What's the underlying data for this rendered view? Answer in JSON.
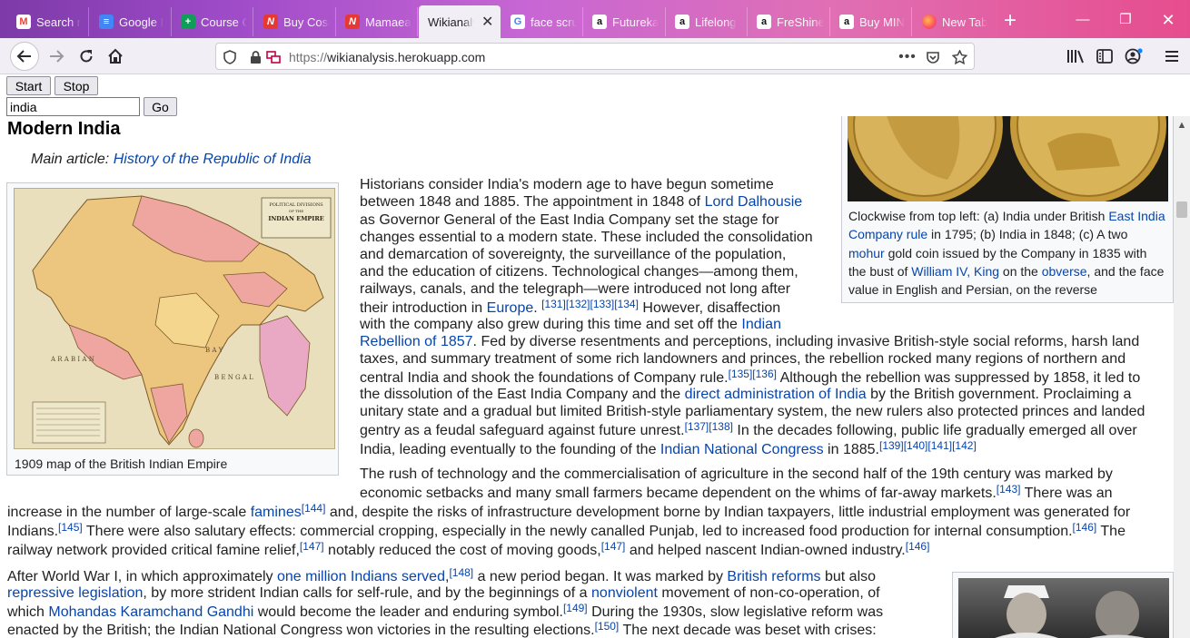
{
  "browser": {
    "tabs": [
      {
        "title": "Search r",
        "icon": "gmail-icon",
        "color": "#ea4335"
      },
      {
        "title": "Google I",
        "icon": "google-docs-icon",
        "color": "#4285f4"
      },
      {
        "title": "Course C",
        "icon": "google-sheets-icon",
        "color": "#0f9d58"
      },
      {
        "title": "Buy Cosr",
        "icon": "brand-n-icon",
        "color": "#e53935"
      },
      {
        "title": "Mamaea",
        "icon": "brand-n-icon",
        "color": "#e53935"
      },
      {
        "title": "Wikianaly",
        "icon": "none",
        "color": "#f1eef5",
        "active": true
      },
      {
        "title": "face scru",
        "icon": "google-icon",
        "color": "#4285f4"
      },
      {
        "title": "Futureka",
        "icon": "amazon-icon",
        "color": "#ffffff"
      },
      {
        "title": "Lifelong",
        "icon": "amazon-icon",
        "color": "#ffffff"
      },
      {
        "title": "FreShine",
        "icon": "amazon-icon",
        "color": "#ffffff"
      },
      {
        "title": "Buy MIN",
        "icon": "amazon-icon",
        "color": "#ffffff"
      },
      {
        "title": "New Tab",
        "icon": "firefox-icon",
        "color": "#ff7139"
      }
    ],
    "url_scheme": "https://",
    "url_host": "wikianalysis.herokuapp.com"
  },
  "controls": {
    "start_label": "Start",
    "stop_label": "Stop",
    "search_value": "india",
    "go_label": "Go"
  },
  "article": {
    "section_title": "Modern India",
    "main_article_prefix": "Main article: ",
    "main_article_link": "History of the Republic of India",
    "map_caption": "1909 map of the British Indian Empire",
    "coin_caption": {
      "t1": "Clockwise from top left: (a) India under British ",
      "l1": "East India Company rule",
      "t2": " in 1795; (b) India in 1848; (c) A two ",
      "l2": "mohur",
      "t3": " gold coin issued by the Company in 1835 with the bust of ",
      "l3": "William IV, King",
      "t4": " on the ",
      "l4": "obverse",
      "t5": ", and the face value in English and Persian, on the reverse"
    },
    "map_labels": {
      "title_small": "POLITICAL DIVISIONS",
      "title_of": "OF THE",
      "title_big": "INDIAN EMPIRE",
      "arabian": "A R A B I A N",
      "bay": "B A Y",
      "bengal": "B E N G A L"
    },
    "refs": {
      "r131": "[131]",
      "r132": "[132]",
      "r133": "[133]",
      "r134": "[134]",
      "r135": "[135]",
      "r136": "[136]",
      "r137": "[137]",
      "r138": "[138]",
      "r139": "[139]",
      "r140": "[140]",
      "r141": "[141]",
      "r142": "[142]",
      "r143": "[143]",
      "r144": "[144]",
      "r145": "[145]",
      "r146": "[146]",
      "r147": "[147]",
      "r148": "[148]",
      "r149": "[149]",
      "r150": "[150]"
    },
    "p1": {
      "l1": "Historians consider India's modern age to have begun sometime",
      "l2a": "between 1848 and 1885. The appointment in 1848 of ",
      "l2link": "Lord Dalhousie",
      "l3": "as Governor General of the East India Company set the stage for",
      "l4": "changes essential to a modern state. These included the consolidation",
      "l5": "and demarcation of sovereignty, the surveillance of the population,",
      "l6": "and the education of citizens. Technological changes—among them,",
      "l7": "railways, canals, and the telegraph—were introduced not long after",
      "l8a": "their introduction in ",
      "l8link": "Europe",
      "l8b": ". ",
      "l8c": " However, disaffection",
      "l9a": "with the company also grew during this time and set off the ",
      "l9link": "Indian",
      "l10link": "Rebellion of 1857",
      "l10b": ". Fed by diverse resentments and perceptions, including invasive British-style social reforms, harsh land",
      "l11": "taxes, and summary treatment of some rich landowners and princes, the rebellion rocked many regions of northern and",
      "l12a": "central India and shook the foundations of Company rule.",
      "l12b": " Although the rebellion was suppressed by 1858, it led to",
      "l13a": "the dissolution of the East India Company and the ",
      "l13link": "direct administration of India",
      "l13b": " by the British government. Proclaiming a",
      "l14": "unitary state and a gradual but limited British-style parliamentary system, the new rulers also protected princes and landed",
      "l15a": "gentry as a feudal safeguard against future unrest.",
      "l15b": " In the decades following, public life gradually emerged all over",
      "l16a": "India, leading eventually to the founding of the ",
      "l16link": "Indian National Congress",
      "l16b": " in 1885."
    },
    "p2": {
      "l1": "The rush of technology and the commercialisation of agriculture in the second half of the 19th century was marked by",
      "l2a": "economic setbacks and many small farmers became dependent on the whims of far-away markets.",
      "l2b": " There was an",
      "l3a": "increase in the number of large-scale ",
      "l3link": "famines",
      "l3b": " and, despite the risks of infrastructure development borne by Indian taxpayers, little industrial employment was generated for",
      "l4a": "Indians.",
      "l4b": " There were also salutary effects: commercial cropping, especially in the newly canalled Punjab, led to increased food production for internal consumption.",
      "l4c": " The",
      "l5a": "railway network provided critical famine relief,",
      "l5b": " notably reduced the cost of moving goods,",
      "l5c": " and helped nascent Indian-owned industry."
    },
    "p3": {
      "l1a": "After World War I, in which approximately ",
      "l1link": "one million Indians served",
      "l1b": " a new period began. It was marked by ",
      "l1link2": "British reforms",
      "l1c": " but also",
      "l2link": "repressive legislation",
      "l2a": ", by more strident Indian calls for self-rule, and by the beginnings of a ",
      "l2link2": "nonviolent",
      "l2b": " movement of non-co-operation, of",
      "l3a": "which ",
      "l3link": "Mohandas Karamchand Gandhi",
      "l3b": " would become the leader and enduring symbol.",
      "l3c": " During the 1930s, slow legislative reform was",
      "l4a": "enacted by the British; the Indian National Congress won victories in the resulting elections.",
      "l4b": " The next decade was beset with crises:"
    }
  }
}
